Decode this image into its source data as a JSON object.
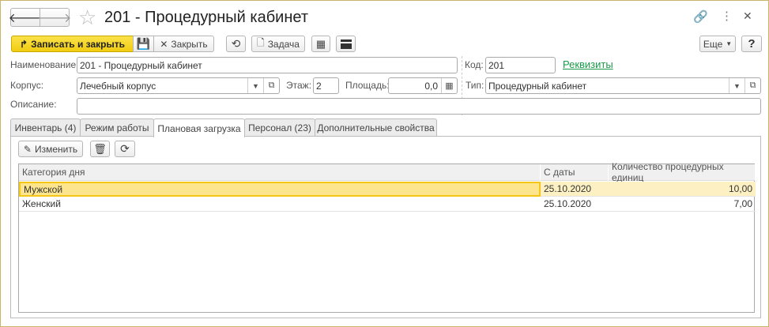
{
  "window": {
    "title": "201 - Процедурный кабинет"
  },
  "toolbar": {
    "save_close": "Записать и закрыть",
    "close": "Закрыть",
    "task": "Задача",
    "more": "Еще",
    "help": "?"
  },
  "form": {
    "name_label": "Наименование:",
    "name_value": "201 - Процедурный кабинет",
    "code_label": "Код:",
    "code_value": "201",
    "requisites_link": "Реквизиты",
    "building_label": "Корпус:",
    "building_value": "Лечебный корпус",
    "floor_label": "Этаж:",
    "floor_value": "2",
    "area_label": "Площадь:",
    "area_value": "0,0",
    "type_label": "Тип:",
    "type_value": "Процедурный кабинет",
    "description_label": "Описание:",
    "description_value": ""
  },
  "tabs": [
    {
      "label": "Инвентарь (4)"
    },
    {
      "label": "Режим работы"
    },
    {
      "label": "Плановая загрузка",
      "active": true
    },
    {
      "label": "Персонал (23)"
    },
    {
      "label": "Дополнительные свойства"
    }
  ],
  "tab_toolbar": {
    "edit": "Изменить"
  },
  "table": {
    "columns": [
      "Категория дня",
      "С даты",
      "Количество процедурных единиц"
    ],
    "rows": [
      [
        "Мужской",
        "25.10.2020",
        "10,00"
      ],
      [
        "Женский",
        "25.10.2020",
        "7,00"
      ]
    ],
    "selected_row": 0
  },
  "colors": {
    "accent": "#f5d320",
    "link": "#1a9a4a",
    "selection": "#fde58e",
    "window_border": "#c9b46a"
  }
}
